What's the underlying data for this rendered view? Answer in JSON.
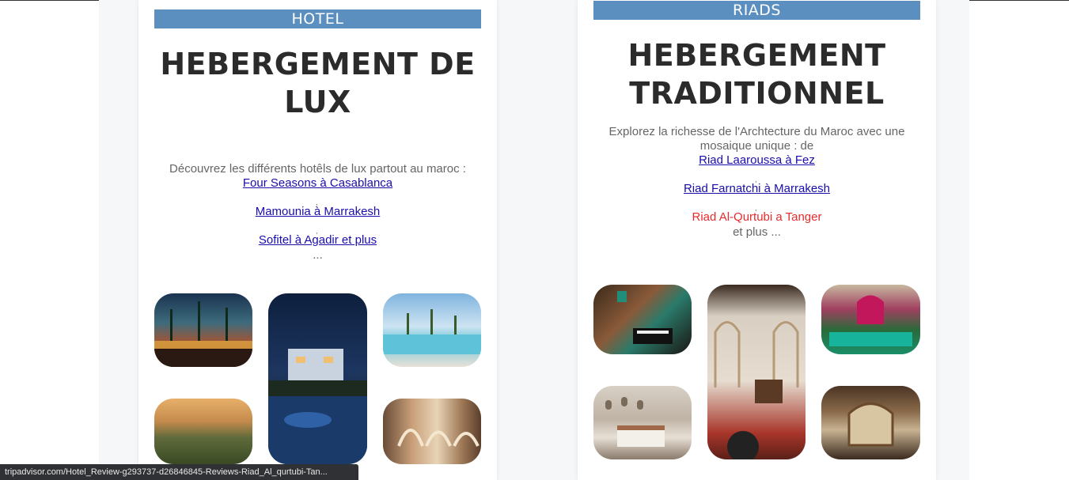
{
  "hotel": {
    "banner": "HOTEL",
    "title_line1": "HEBERGEMENT DE",
    "title_line2": "LUX",
    "intro": "Découvrez les différents hotêls de lux partout au maroc :",
    "links": [
      "Four Seasons à Casablanca",
      "Mamounia à Marrakesh",
      "Sofitel à Agadir et plus"
    ],
    "separator": ",",
    "ellipsis": "..."
  },
  "riads": {
    "banner": "RIADS",
    "title_line1": "HEBERGEMENT",
    "title_line2": "TRADITIONNEL",
    "intro_line1": "Explorez la richesse de l'Archtecture du Maroc avec une",
    "intro_line2": "mosaique unique : de",
    "links": [
      "Riad Laaroussa à Fez",
      "Riad Farnatchi à Marrakesh",
      "Riad Al-Qurtubi a Tanger"
    ],
    "separator": ",",
    "outro": "et plus ..."
  },
  "status_url": "tripadvisor.com/Hotel_Review-g293737-d26846845-Reviews-Riad_Al_qurtubi-Tan...",
  "colors": {
    "banner": "#5b8fc0",
    "link": "#1a0dab",
    "hover_link": "#e52b2b"
  }
}
